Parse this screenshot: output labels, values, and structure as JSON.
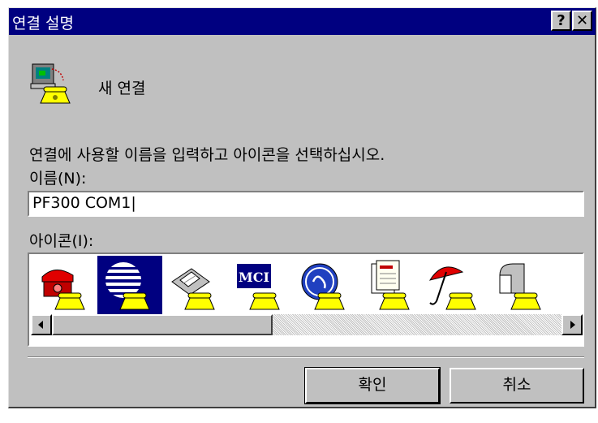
{
  "window": {
    "title": "연결 설명",
    "help_label": "?",
    "close_label": "✕"
  },
  "app": {
    "name": "새 연결",
    "icon": "phone-computer-icon"
  },
  "instruction": "연결에 사용할 이름을 입력하고 아이콘을 선택하십시오.",
  "name_field": {
    "label": "이름(N):",
    "value": "PF300 COM1|"
  },
  "icon_field": {
    "label": "아이콘(I):",
    "selected_index": 1,
    "icons": [
      "red-phone-icon",
      "att-globe-icon",
      "fax-phone-icon",
      "mci-logo-icon",
      "ge-logo-icon",
      "document-phone-icon",
      "umbrella-phone-icon",
      "mailbox-phone-icon"
    ],
    "mci_text": "MCI",
    "scroll_position": 0
  },
  "buttons": {
    "ok_label": "확인",
    "cancel_label": "취소"
  },
  "colors": {
    "title_bar": "#000080",
    "dialog_bg": "#c0c0c0",
    "selection": "#000080"
  }
}
